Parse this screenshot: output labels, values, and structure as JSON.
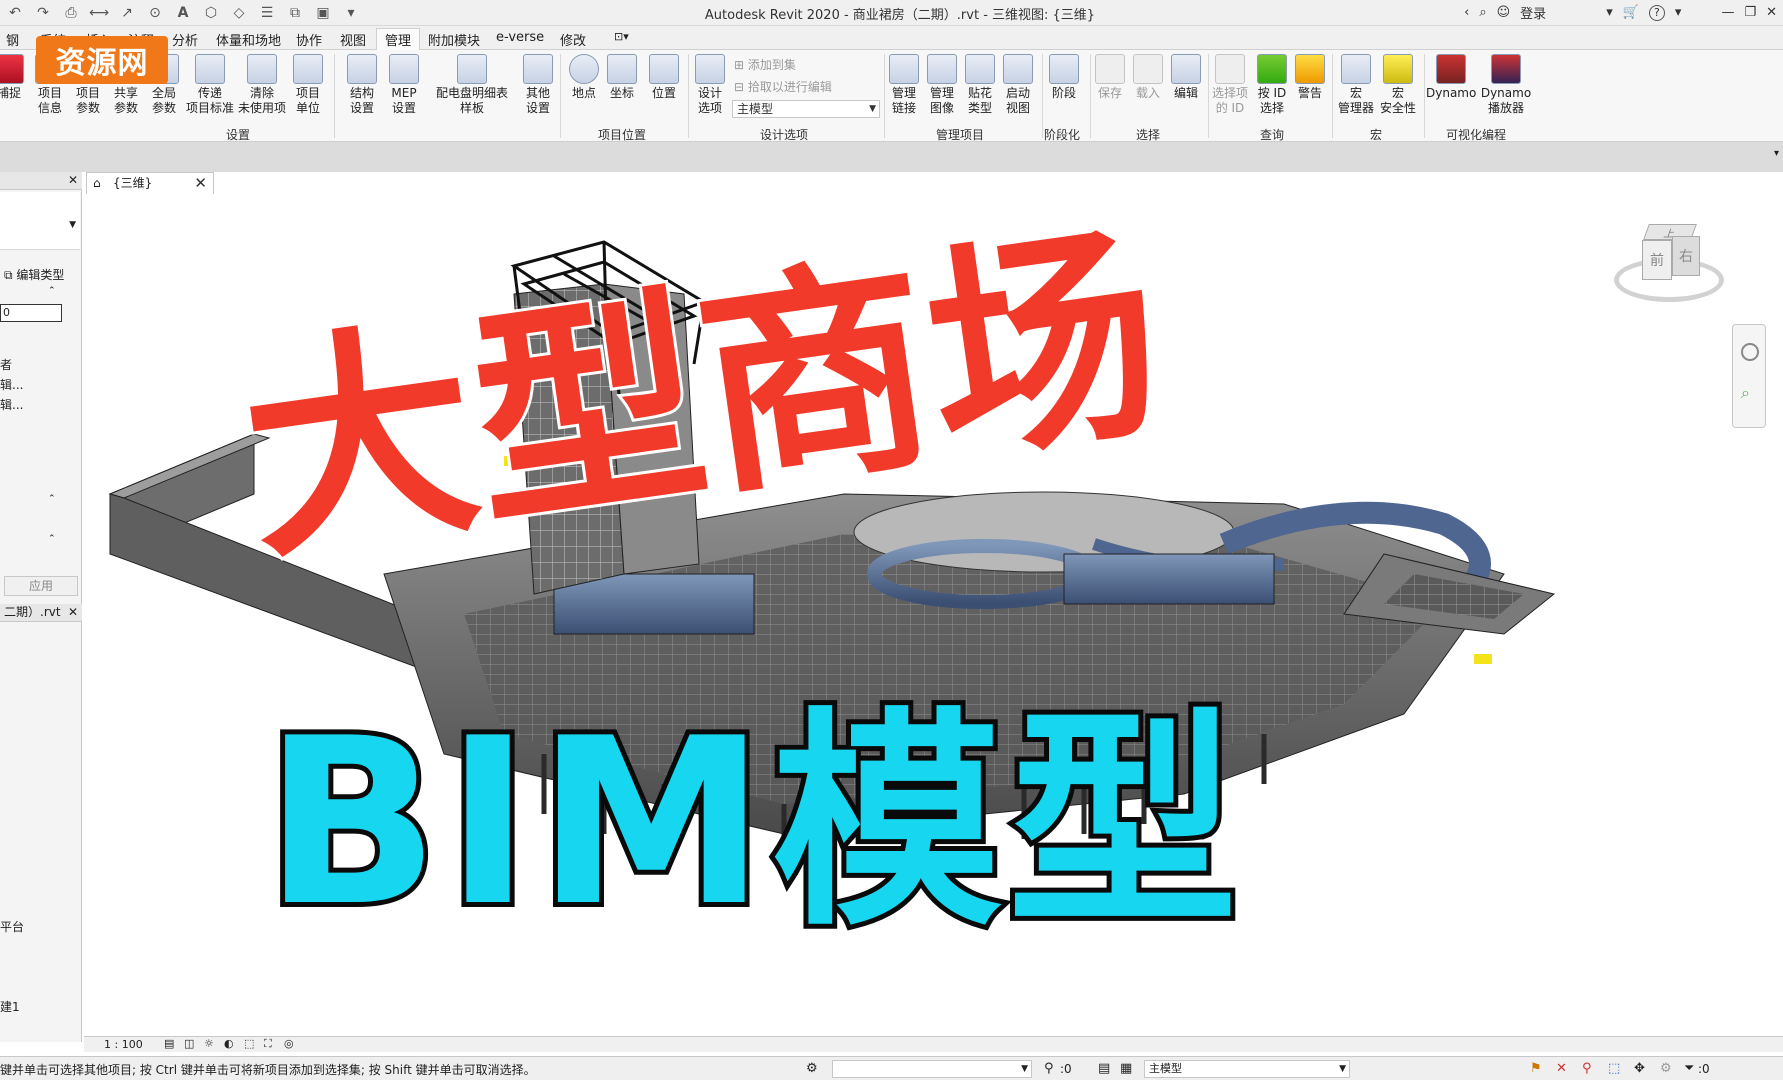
{
  "window": {
    "title": "Autodesk Revit 2020 - 商业裙房（二期）.rvt - 三维视图: {三维}",
    "login": "登录",
    "help": "?"
  },
  "menu_tabs": [
    "钢",
    "系统",
    "插入",
    "注释",
    "分析",
    "体量和场地",
    "协作",
    "视图",
    "管理",
    "附加模块",
    "e-verse",
    "修改"
  ],
  "active_tab": "管理",
  "logo_text": "资源网",
  "ribbon": {
    "left_clip": "捕捉",
    "buttons_settings": [
      {
        "label": "项目\n信息"
      },
      {
        "label": "项目\n参数"
      },
      {
        "label": "共享\n参数"
      },
      {
        "label": "全局\n参数"
      },
      {
        "label": "传递\n项目标准"
      },
      {
        "label": "清除\n未使用项"
      },
      {
        "label": "项目\n单位"
      },
      {
        "label": "结构\n设置"
      },
      {
        "label": "MEP\n设置"
      },
      {
        "label": "配电盘明细表\n样板"
      },
      {
        "label": "其他\n设置"
      }
    ],
    "group_settings": "设置",
    "buttons_location": [
      {
        "label": "地点"
      },
      {
        "label": "坐标"
      },
      {
        "label": "位置"
      }
    ],
    "group_location": "项目位置",
    "design_option": {
      "button": "设计\n选项",
      "add": "添加到集",
      "pick": "拾取以进行编辑",
      "dropdown": "主模型",
      "group": "设计选项"
    },
    "buttons_manage": [
      {
        "label": "管理\n链接"
      },
      {
        "label": "管理\n图像"
      },
      {
        "label": "贴花\n类型"
      },
      {
        "label": "启动\n视图"
      }
    ],
    "group_manage": "管理项目",
    "phase": {
      "label": "阶段",
      "group": "阶段化"
    },
    "buttons_select": [
      {
        "label": "保存"
      },
      {
        "label": "载入"
      },
      {
        "label": "编辑"
      }
    ],
    "group_select": "选择",
    "buttons_query": [
      {
        "label": "选择项\n的 ID"
      },
      {
        "label": "按 ID\n选择"
      },
      {
        "label": "警告"
      }
    ],
    "group_query": "查询",
    "buttons_macro": [
      {
        "label": "宏\n管理器"
      },
      {
        "label": "宏\n安全性"
      }
    ],
    "group_macro": "宏",
    "buttons_vp": [
      {
        "label": "Dynamo"
      },
      {
        "label": "Dynamo\n播放器"
      }
    ],
    "group_vp": "可视化编程"
  },
  "left_panel": {
    "edit_type": "编辑类型",
    "row_value": "0",
    "row_a": "者",
    "row_b": "辑...",
    "row_c": "辑...",
    "apply": "应用",
    "project_title": "二期）.rvt",
    "item1": "平台",
    "item2": "建1"
  },
  "view_tab": {
    "label": "{三维}"
  },
  "viewcube": {
    "front": "前",
    "right": "右",
    "top": "上"
  },
  "overlay": {
    "red_text": "大型商场",
    "cyan_text": "BIM模型"
  },
  "view_bar": {
    "scale": "1 : 100"
  },
  "status": {
    "text": "键并单击可选择其他项目; 按 Ctrl 键并单击可将新项目添加到选择集; 按 Shift 键并单击可取消选择。",
    "zero1": ":0",
    "model": "主模型",
    "zero2": ":0"
  }
}
